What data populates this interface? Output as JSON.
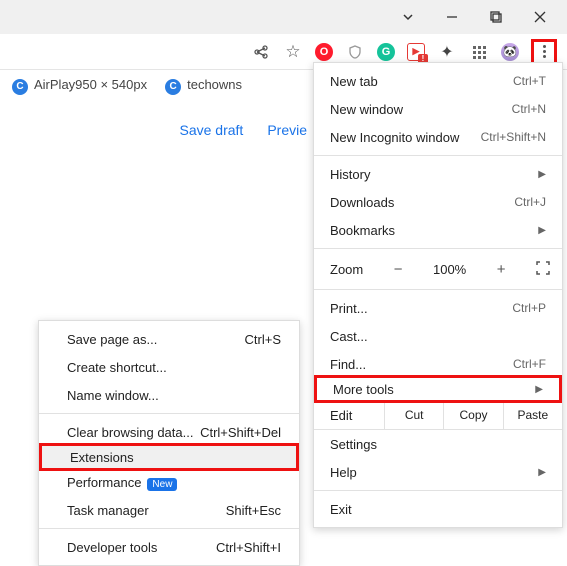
{
  "window": {
    "titlebar": true
  },
  "toolbar": {
    "icons": [
      "share-icon",
      "star-icon",
      "opera-icon",
      "shield-icon",
      "grammarly-icon",
      "video-dl-icon",
      "puzzle-icon",
      "grid-icon",
      "avatar-icon",
      "menu-icon"
    ]
  },
  "tabs": {
    "items": [
      {
        "label": "AirPlay950 × 540px"
      },
      {
        "label": "techowns"
      }
    ]
  },
  "page": {
    "links": {
      "save": "Save draft",
      "preview": "Previe"
    }
  },
  "menu": {
    "new_tab": "New tab",
    "sc_new_tab": "Ctrl+T",
    "new_window": "New window",
    "sc_new_window": "Ctrl+N",
    "new_incognito": "New Incognito window",
    "sc_new_incognito": "Ctrl+Shift+N",
    "history": "History",
    "downloads": "Downloads",
    "sc_downloads": "Ctrl+J",
    "bookmarks": "Bookmarks",
    "zoom_label": "Zoom",
    "zoom_pct": "100%",
    "print": "Print...",
    "sc_print": "Ctrl+P",
    "cast": "Cast...",
    "find": "Find...",
    "sc_find": "Ctrl+F",
    "more_tools": "More tools",
    "edit": "Edit",
    "cut": "Cut",
    "copy": "Copy",
    "paste": "Paste",
    "settings": "Settings",
    "help": "Help",
    "exit": "Exit"
  },
  "submenu": {
    "save_page": "Save page as...",
    "sc_save_page": "Ctrl+S",
    "create_shortcut": "Create shortcut...",
    "name_window": "Name window...",
    "clear_data": "Clear browsing data...",
    "sc_clear_data": "Ctrl+Shift+Del",
    "extensions": "Extensions",
    "performance": "Performance",
    "perf_badge": "New",
    "task_manager": "Task manager",
    "sc_task_manager": "Shift+Esc",
    "dev_tools": "Developer tools",
    "sc_dev_tools": "Ctrl+Shift+I"
  }
}
